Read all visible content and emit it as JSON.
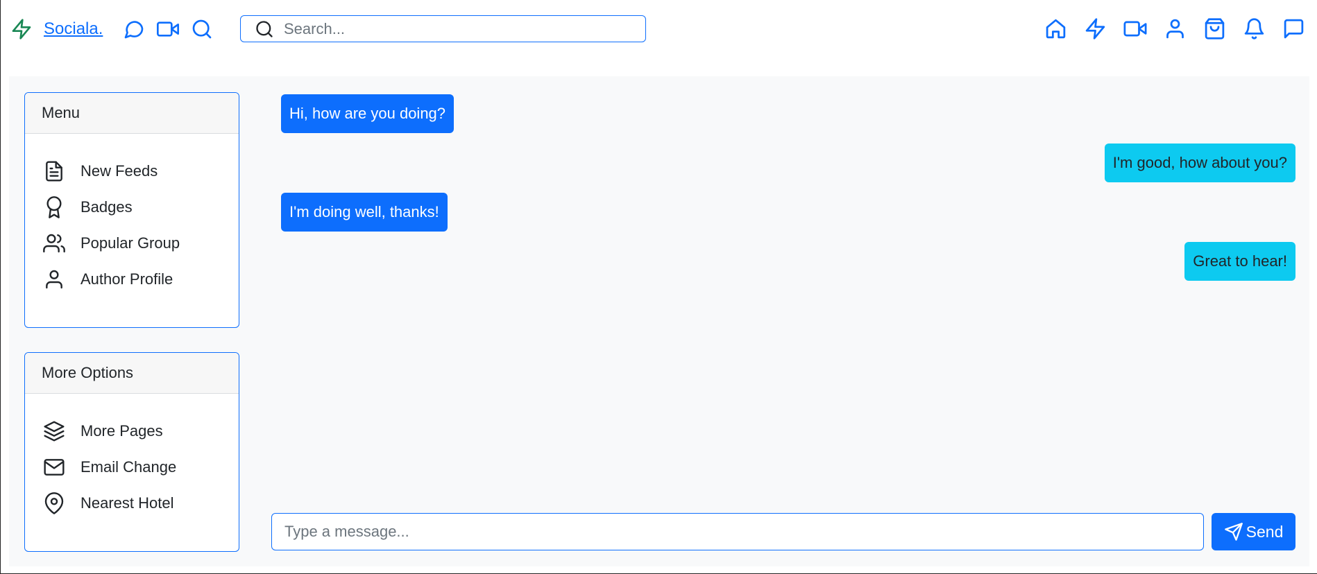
{
  "navbar": {
    "brand_name": "Sociala.",
    "brand_icon": "lightning-icon",
    "left_icons": [
      "chat-bubble-icon",
      "video-camera-icon",
      "search-icon"
    ],
    "search": {
      "placeholder": "Search...",
      "value": ""
    },
    "right_icons": [
      "home-icon",
      "lightning-icon",
      "video-camera-icon",
      "user-icon",
      "shopping-bag-icon",
      "bell-icon",
      "message-square-icon"
    ]
  },
  "sidebar": {
    "menu": {
      "title": "Menu",
      "items": [
        {
          "label": "New Feeds",
          "icon": "document-icon"
        },
        {
          "label": "Badges",
          "icon": "award-icon"
        },
        {
          "label": "Popular Group",
          "icon": "users-icon"
        },
        {
          "label": "Author Profile",
          "icon": "user-icon"
        }
      ]
    },
    "more_options": {
      "title": "More Options",
      "items": [
        {
          "label": "More Pages",
          "icon": "layers-icon"
        },
        {
          "label": "Email Change",
          "icon": "mail-icon"
        },
        {
          "label": "Nearest Hotel",
          "icon": "map-pin-icon"
        }
      ]
    }
  },
  "chat": {
    "messages": [
      {
        "text": "Hi, how are you doing?",
        "direction": "sent"
      },
      {
        "text": "I'm good, how about you?",
        "direction": "received"
      },
      {
        "text": "I'm doing well, thanks!",
        "direction": "sent"
      },
      {
        "text": "Great to hear!",
        "direction": "received"
      }
    ],
    "composer": {
      "placeholder": "Type a message...",
      "value": ""
    },
    "send_label": "Send"
  },
  "colors": {
    "primary": "#0d6efd",
    "info": "#0dcaf0",
    "brand_icon": "#198754",
    "background": "#f8f9fa"
  }
}
